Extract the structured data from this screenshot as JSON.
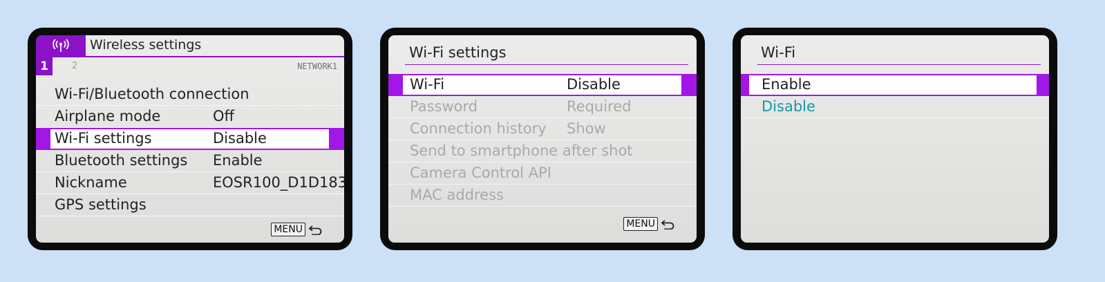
{
  "screens": [
    {
      "title": "Wireless settings",
      "icon": "wireless-icon",
      "tabs": [
        "1",
        "2"
      ],
      "page_label": "NETWORK1",
      "items": [
        {
          "label": "Wi-Fi/Bluetooth connection",
          "value": ""
        },
        {
          "label": "Airplane mode",
          "value": "Off"
        },
        {
          "label": "Wi-Fi settings",
          "value": "Disable"
        },
        {
          "label": "Bluetooth settings",
          "value": "Enable"
        },
        {
          "label": "Nickname",
          "value": "EOSR100_D1D183"
        },
        {
          "label": "GPS settings",
          "value": ""
        }
      ],
      "menu_label": "MENU"
    },
    {
      "title": "Wi-Fi settings",
      "items": [
        {
          "label": "Wi-Fi",
          "value": "Disable"
        },
        {
          "label": "Password",
          "value": "Required"
        },
        {
          "label": "Connection history",
          "value": "Show"
        },
        {
          "label": "Send to smartphone after shot",
          "value": ""
        },
        {
          "label": "Camera Control API",
          "value": ""
        },
        {
          "label": "MAC address",
          "value": ""
        }
      ],
      "menu_label": "MENU"
    },
    {
      "title": "Wi-Fi",
      "options": [
        {
          "label": "Enable"
        },
        {
          "label": "Disable"
        }
      ]
    }
  ],
  "colors": {
    "background": "#cce0f6",
    "highlight": "#a216e8",
    "header_accent": "#8b12c6",
    "current_value": "#1597a8"
  }
}
